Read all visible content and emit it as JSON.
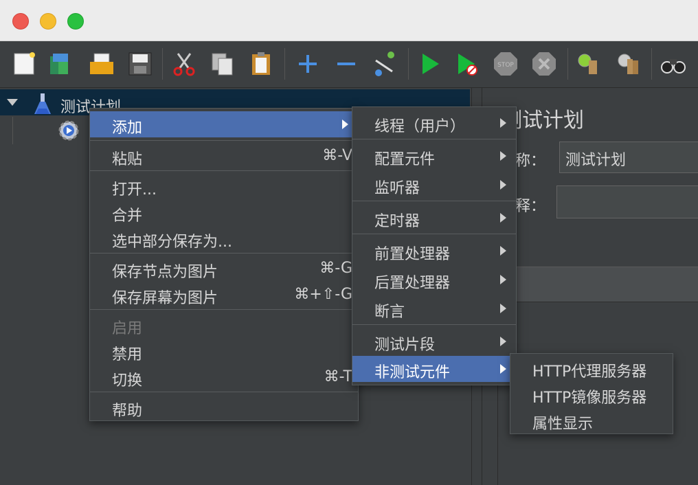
{
  "toolbar": {
    "buttons": [
      {
        "name": "new-icon"
      },
      {
        "name": "templates-icon"
      },
      {
        "name": "open-icon"
      },
      {
        "name": "save-icon"
      },
      {
        "name": "cut-icon"
      },
      {
        "name": "copy-icon"
      },
      {
        "name": "paste-icon"
      },
      {
        "name": "expand-icon"
      },
      {
        "name": "collapse-icon"
      },
      {
        "name": "toggle-icon"
      },
      {
        "name": "start-icon"
      },
      {
        "name": "start-no-pause-icon"
      },
      {
        "name": "stop-icon"
      },
      {
        "name": "shutdown-icon"
      },
      {
        "name": "clear-icon"
      },
      {
        "name": "clear-all-icon"
      },
      {
        "name": "search-icon"
      }
    ]
  },
  "tree": {
    "root_label": "测试计划"
  },
  "right_panel": {
    "title": "测试计划",
    "name_label": "称：",
    "name_value": "测试计划",
    "comment_label": "释："
  },
  "context_menu": {
    "items": [
      {
        "label": "添加",
        "has_submenu": true,
        "selected": true
      },
      {
        "label": "粘贴",
        "shortcut": "⌘-V"
      },
      {
        "label": "打开..."
      },
      {
        "label": "合并"
      },
      {
        "label": "选中部分保存为..."
      },
      {
        "label": "保存节点为图片",
        "shortcut": "⌘-G"
      },
      {
        "label": "保存屏幕为图片",
        "shortcut": "⌘+⇧-G"
      },
      {
        "label": "启用",
        "disabled": true
      },
      {
        "label": "禁用"
      },
      {
        "label": "切换",
        "shortcut": "⌘-T"
      },
      {
        "label": "帮助"
      }
    ]
  },
  "add_submenu": {
    "items": [
      {
        "label": "线程（用户）"
      },
      {
        "label": "配置元件"
      },
      {
        "label": "监听器"
      },
      {
        "label": "定时器"
      },
      {
        "label": "前置处理器"
      },
      {
        "label": "后置处理器"
      },
      {
        "label": "断言"
      },
      {
        "label": "测试片段"
      },
      {
        "label": "非测试元件",
        "selected": true
      }
    ]
  },
  "non_test_submenu": {
    "items": [
      {
        "label": "HTTP代理服务器"
      },
      {
        "label": "HTTP镜像服务器"
      },
      {
        "label": "属性显示"
      }
    ]
  },
  "colors": {
    "background": "#3c3f41",
    "selection": "#4b6eaf",
    "text": "#d6d6d6",
    "disabled_text": "#7b7b7b"
  }
}
